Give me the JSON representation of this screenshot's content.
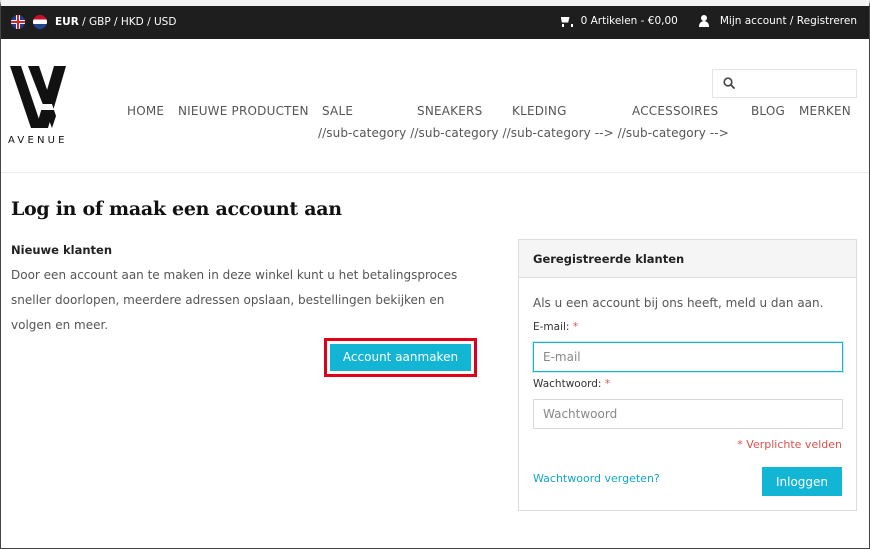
{
  "topbar": {
    "currencies": [
      "EUR",
      "GBP",
      "HKD",
      "USD"
    ],
    "cart": "0 Artikelen - €0,00",
    "account": "Mijn account / Registreren"
  },
  "logo": {
    "text": "AVENUE"
  },
  "nav": {
    "items": [
      "HOME",
      "NIEUWE PRODUCTEN",
      "SALE",
      "SNEAKERS",
      "KLEDING",
      "ACCESSOIRES",
      "BLOG",
      "MERKEN"
    ],
    "subcategory_line": "//sub-category //sub-category //sub-category --> //sub-category -->"
  },
  "main": {
    "title": "Log in of maak een account aan",
    "new_customers": {
      "title": "Nieuwe klanten",
      "text": "Door een account aan te maken in deze winkel kunt u het betalingsproces sneller doorlopen, meerdere adressen opslaan, bestellingen bekijken en volgen en meer.",
      "button": "Account aanmaken"
    },
    "registered": {
      "title": "Geregistreerde klanten",
      "intro": "Als u een account bij ons heeft, meld u dan aan.",
      "email_label": "E-mail:",
      "email_placeholder": "E-mail",
      "password_label": "Wachtwoord:",
      "password_placeholder": "Wachtwoord",
      "required_mark": "*",
      "required_note": "* Verplichte velden",
      "forgot": "Wachtwoord vergeten?",
      "login_button": "Inloggen"
    }
  },
  "colors": {
    "accent": "#12b6d4",
    "topbar_bg": "#1e1e1e",
    "highlight": "#e0001a",
    "required": "#d9534f"
  },
  "icons": [
    "uk-flag-icon",
    "nl-flag-icon",
    "cart-icon",
    "user-icon",
    "search-icon"
  ]
}
